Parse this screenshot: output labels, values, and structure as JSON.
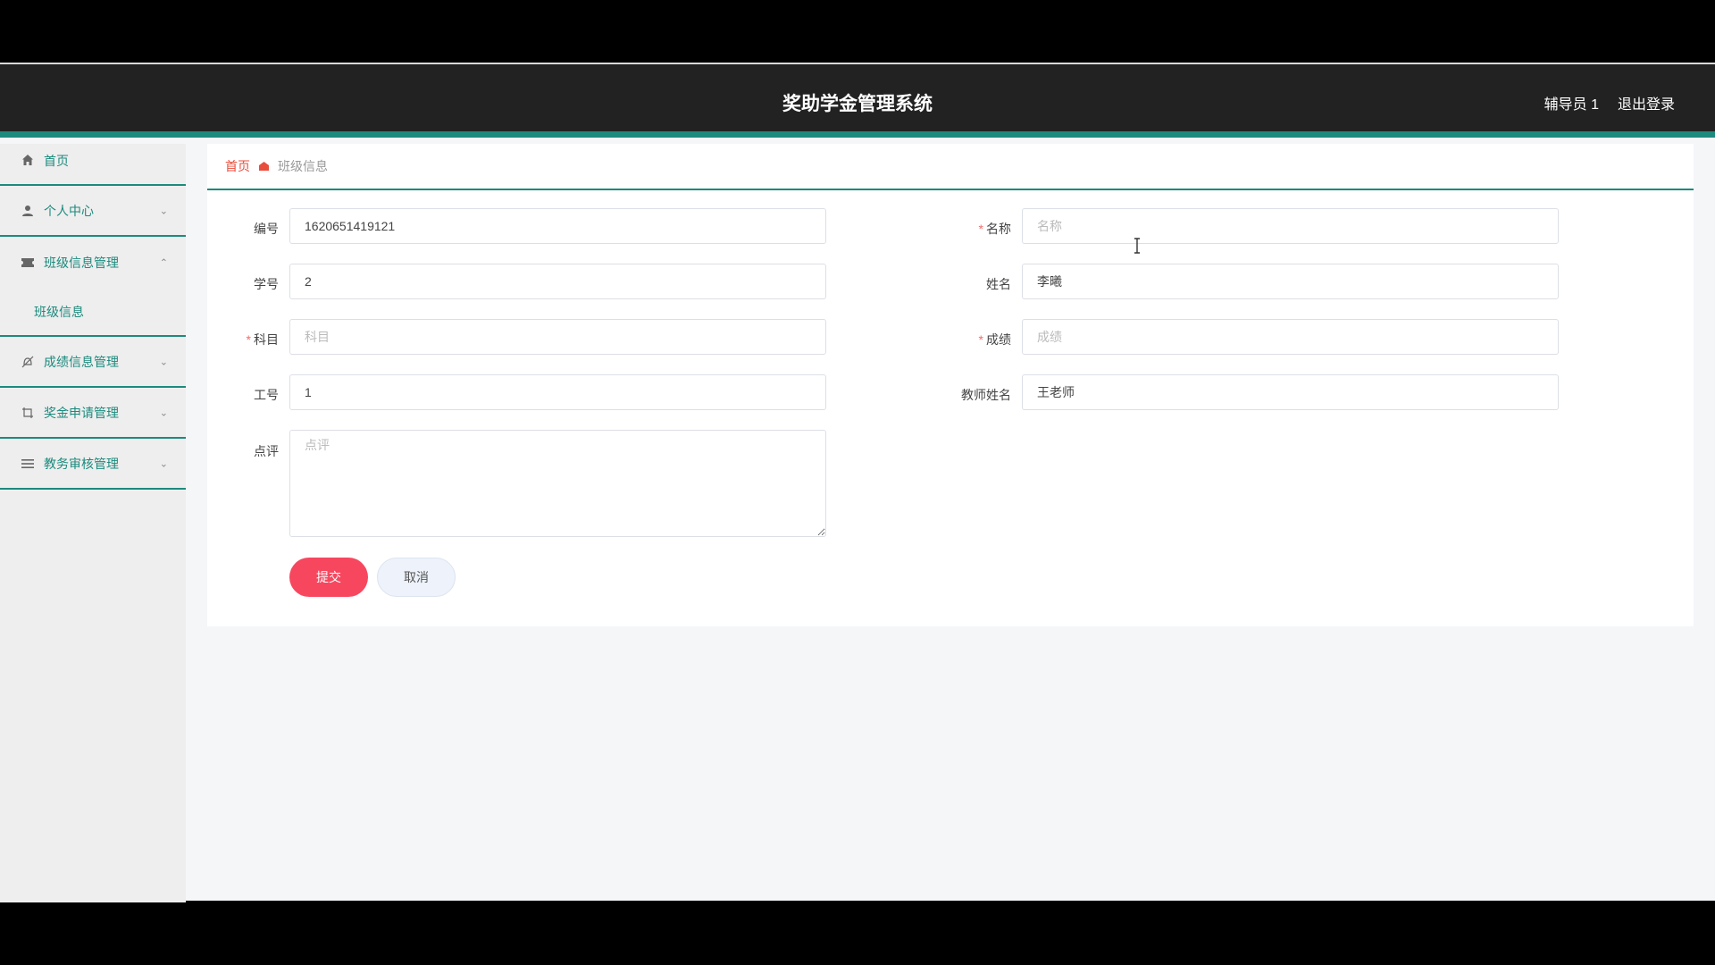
{
  "header": {
    "title": "奖助学金管理系统",
    "user": "辅导员 1",
    "logout": "退出登录"
  },
  "sidebar": {
    "items": [
      {
        "label": "首页",
        "icon": "home-icon"
      },
      {
        "label": "个人中心",
        "icon": "user-icon"
      },
      {
        "label": "班级信息管理",
        "icon": "ticket-icon",
        "expanded": true
      },
      {
        "label": "班级信息",
        "sub": true
      },
      {
        "label": "成绩信息管理",
        "icon": "bell-off-icon"
      },
      {
        "label": "奖金申请管理",
        "icon": "crop-icon"
      },
      {
        "label": "教务审核管理",
        "icon": "menu-icon"
      }
    ]
  },
  "breadcrumb": {
    "home": "首页",
    "current": "班级信息"
  },
  "form": {
    "bianhao": {
      "label": "编号",
      "value": "1620651419121"
    },
    "mingcheng": {
      "label": "名称",
      "required": true,
      "placeholder": "名称",
      "value": ""
    },
    "xuehao": {
      "label": "学号",
      "value": "2"
    },
    "xingming": {
      "label": "姓名",
      "value": "李曦"
    },
    "kemu": {
      "label": "科目",
      "required": true,
      "placeholder": "科目",
      "value": ""
    },
    "chengji": {
      "label": "成绩",
      "required": true,
      "placeholder": "成绩",
      "value": ""
    },
    "gonghao": {
      "label": "工号",
      "value": "1"
    },
    "jiaoshi": {
      "label": "教师姓名",
      "value": "王老师"
    },
    "dianping": {
      "label": "点评",
      "placeholder": "点评",
      "value": ""
    },
    "submit": "提交",
    "cancel": "取消"
  },
  "colors": {
    "accent": "#1c8a7d",
    "header_bg": "#222222",
    "submit": "#f7475f",
    "breadcrumb_home": "#e94e3d"
  }
}
